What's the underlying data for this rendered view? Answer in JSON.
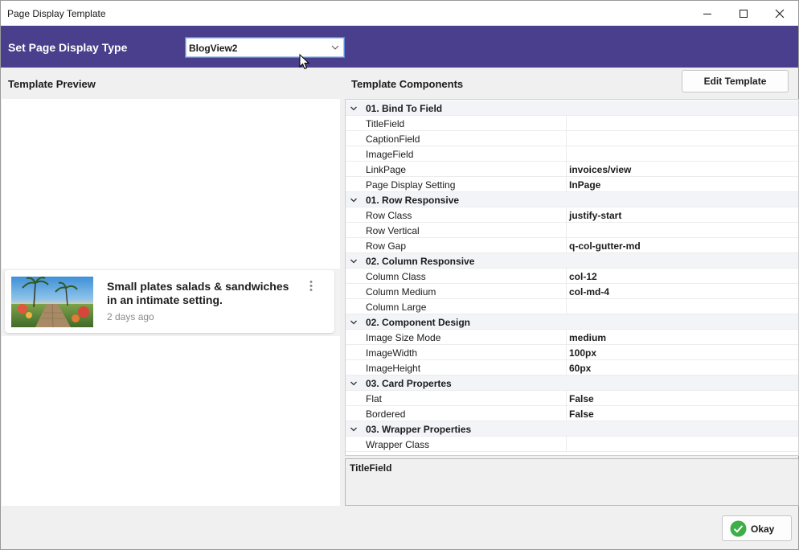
{
  "window": {
    "title": "Page Display Template"
  },
  "header": {
    "label": "Set Page Display Type",
    "select_value": "BlogView2",
    "color": "#4a3f8c"
  },
  "preview": {
    "label": "Template Preview",
    "card": {
      "title": "Small plates salads & sandwiches in an intimate setting.",
      "time": "2 days ago"
    }
  },
  "components": {
    "label": "Template Components",
    "edit_button": "Edit Template",
    "rows": [
      {
        "type": "category",
        "name": "01. Bind To Field"
      },
      {
        "type": "prop",
        "name": "TitleField",
        "value": ""
      },
      {
        "type": "prop",
        "name": "CaptionField",
        "value": ""
      },
      {
        "type": "prop",
        "name": "ImageField",
        "value": ""
      },
      {
        "type": "prop",
        "name": "LinkPage",
        "value": "invoices/view"
      },
      {
        "type": "prop",
        "name": "Page Display Setting",
        "value": "InPage"
      },
      {
        "type": "category",
        "name": "01. Row Responsive"
      },
      {
        "type": "prop",
        "name": "Row Class",
        "value": "justify-start"
      },
      {
        "type": "prop",
        "name": "Row Vertical",
        "value": ""
      },
      {
        "type": "prop",
        "name": "Row Gap",
        "value": "q-col-gutter-md"
      },
      {
        "type": "category",
        "name": "02. Column Responsive"
      },
      {
        "type": "prop",
        "name": "Column Class",
        "value": "col-12"
      },
      {
        "type": "prop",
        "name": "Column Medium",
        "value": "col-md-4"
      },
      {
        "type": "prop",
        "name": "Column Large",
        "value": ""
      },
      {
        "type": "category",
        "name": "02. Component Design"
      },
      {
        "type": "prop",
        "name": "Image Size Mode",
        "value": "medium"
      },
      {
        "type": "prop",
        "name": "ImageWidth",
        "value": "100px"
      },
      {
        "type": "prop",
        "name": "ImageHeight",
        "value": "60px"
      },
      {
        "type": "category",
        "name": "03. Card Propertes"
      },
      {
        "type": "prop",
        "name": "Flat",
        "value": "False"
      },
      {
        "type": "prop",
        "name": "Bordered",
        "value": "False"
      },
      {
        "type": "category",
        "name": "03. Wrapper Properties"
      },
      {
        "type": "prop",
        "name": "Wrapper Class",
        "value": ""
      }
    ],
    "description_title": "TitleField"
  },
  "footer": {
    "okay_label": "Okay",
    "okay_icon_color": "#3fae49"
  },
  "icons": {
    "minimize": "minimize-icon",
    "maximize": "maximize-icon",
    "close": "close-icon",
    "dropdown": "chevron-down-icon",
    "expand": "chevron-expanded-icon",
    "more": "more-vertical-icon",
    "check": "check-circle-icon",
    "cursor": "mouse-pointer-icon"
  }
}
